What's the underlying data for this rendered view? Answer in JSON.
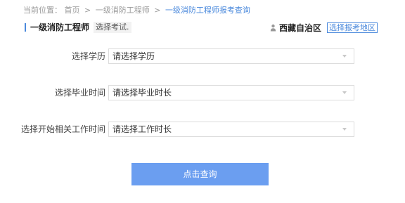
{
  "breadcrumb": {
    "prefix": "当前位置：",
    "items": [
      {
        "label": "首页"
      },
      {
        "label": "一级消防工程师"
      },
      {
        "label": "一级消防工程师报考查询"
      }
    ],
    "separator": ">"
  },
  "header": {
    "title": "一级消防工程师",
    "hint": "选择考试.",
    "region_icon": "location-pin-icon",
    "region_name": "西藏自治区",
    "region_button": "选择报考地区"
  },
  "form": {
    "fields": [
      {
        "label": "选择学历",
        "value": "请选择学历"
      },
      {
        "label": "选择毕业时间",
        "value": "请选择毕业时长"
      },
      {
        "label": "选择开始相关工作时间",
        "value": "请选择工作时长"
      }
    ],
    "submit_label": "点击查询"
  },
  "colors": {
    "accent": "#4a89dc",
    "button": "#6b9ef0",
    "muted_text": "#9a9a9a",
    "border": "#dcdcdc"
  }
}
